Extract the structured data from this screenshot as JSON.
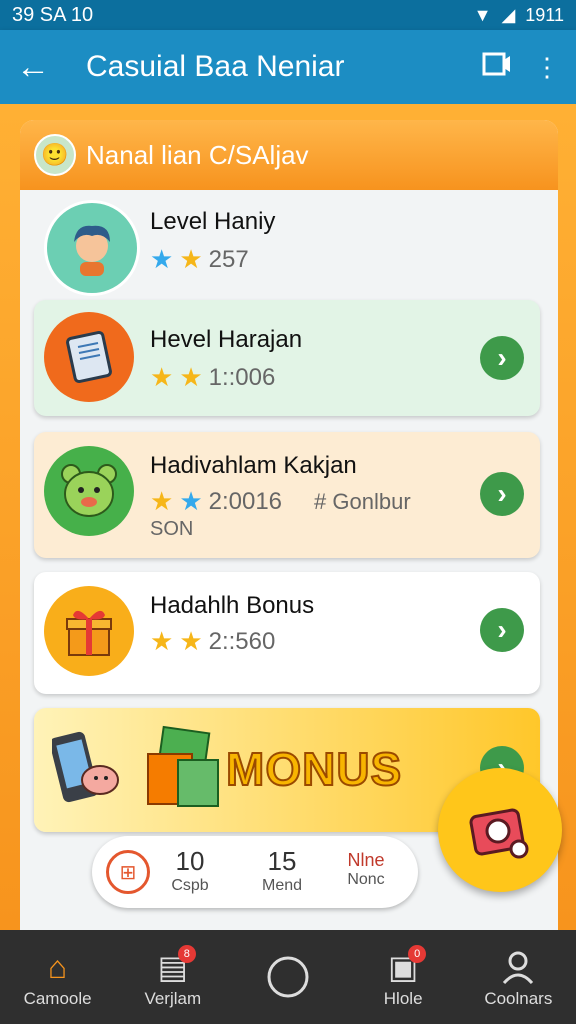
{
  "status_bar": {
    "time": "39 SA 10",
    "right_text": "1911"
  },
  "app_bar": {
    "title": "Casuial Baa Neniar",
    "back_icon": "arrow-left-icon",
    "actions": [
      "film-icon",
      "more-vert-icon"
    ]
  },
  "panel": {
    "title": "Nanal lian C/SAljav"
  },
  "rows": [
    {
      "name": "Level Haniy",
      "stars": [
        "blue",
        "gold"
      ],
      "value": "257"
    },
    {
      "name": "Hevel Harajan",
      "stars": [
        "gold",
        "gold"
      ],
      "value": "1::006"
    },
    {
      "name": "Hadivahlam Kakjan",
      "stars": [
        "gold",
        "blue"
      ],
      "value": "2:0016",
      "extra": "# Gonlbur",
      "sub": "SON"
    },
    {
      "name": "Hadahlh Bonus",
      "stars": [
        "gold",
        "gold"
      ],
      "value": "2::560"
    }
  ],
  "bonus": {
    "label": "MONUS"
  },
  "stats": [
    {
      "value": "10",
      "label": "Cspb"
    },
    {
      "value": "15",
      "label": "Mend"
    },
    {
      "value": "Nlne",
      "label": "Nonc"
    }
  ],
  "nav": [
    {
      "label": "Camoole",
      "icon": "home-icon",
      "active": true
    },
    {
      "label": "Verjlam",
      "icon": "list-icon",
      "badge": "8"
    },
    {
      "label": "",
      "icon": "compass-icon"
    },
    {
      "label": "Hlole",
      "icon": "inbox-icon",
      "badge": "0"
    },
    {
      "label": "Coolnars",
      "icon": "user-icon"
    }
  ],
  "colors": {
    "app_bar": "#1c8dc3",
    "accent": "#f7941d",
    "go_button": "#3e9a4a",
    "fab": "#ffc61a"
  }
}
